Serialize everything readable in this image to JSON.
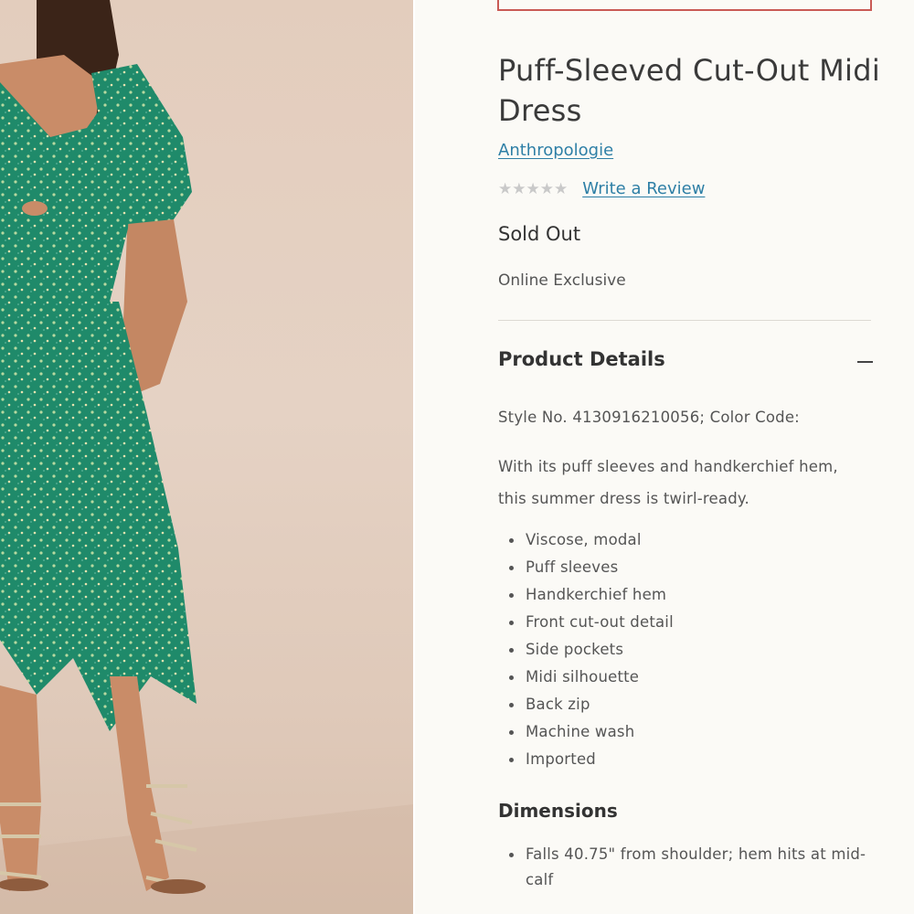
{
  "product": {
    "title": "Puff-Sleeved Cut-Out Midi Dress",
    "brand": "Anthropologie",
    "rating": {
      "stars": "★★★★★",
      "filled": 0,
      "review_link": "Write a Review"
    },
    "status": "Sold Out",
    "badge": "Online Exclusive"
  },
  "details": {
    "header": "Product Details",
    "collapse_icon": "minus-icon",
    "style_line": "Style No. 4130916210056; Color Code:",
    "description": "With its puff sleeves and handkerchief hem, this summer dress is twirl-ready.",
    "features": [
      "Viscose, modal",
      "Puff sleeves",
      "Handkerchief hem",
      "Front cut-out detail",
      "Side pockets",
      "Midi silhouette",
      "Back zip",
      "Machine wash",
      "Imported"
    ]
  },
  "dimensions": {
    "header": "Dimensions",
    "items": [
      "Falls 40.75\" from shoulder; hem hits at mid-calf"
    ]
  },
  "colors": {
    "link": "#2e7fa6",
    "dress": "#1f8a6a",
    "top_box_border": "#c95a55",
    "background": "#fbfaf6"
  }
}
